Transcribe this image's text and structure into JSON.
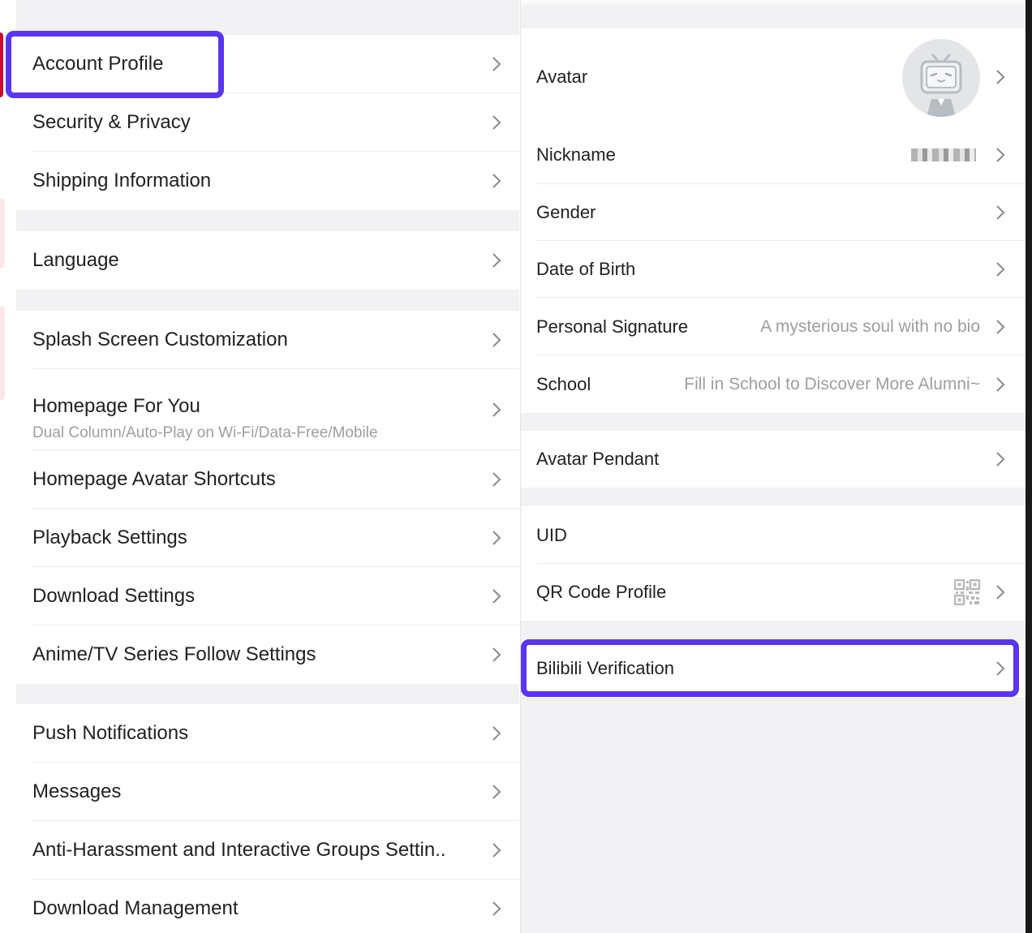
{
  "settings_menu": {
    "account_profile": "Account Profile",
    "security_privacy": "Security & Privacy",
    "shipping_information": "Shipping Information",
    "language": "Language",
    "splash_screen": "Splash Screen Customization",
    "homepage_for_you": "Homepage For You",
    "homepage_for_you_sub": "Dual Column/Auto-Play on Wi-Fi/Data-Free/Mobile",
    "homepage_avatar_shortcuts": "Homepage Avatar Shortcuts",
    "playback_settings": "Playback Settings",
    "download_settings": "Download Settings",
    "anime_tv_follow": "Anime/TV Series Follow Settings",
    "push_notifications": "Push Notifications",
    "messages": "Messages",
    "anti_harassment": "Anti-Harassment and Interactive Groups Settin..",
    "download_management": "Download Management"
  },
  "profile": {
    "avatar": "Avatar",
    "nickname": "Nickname",
    "gender": "Gender",
    "date_of_birth": "Date of Birth",
    "personal_signature": "Personal Signature",
    "personal_signature_value": "A mysterious soul with no bio",
    "school": "School",
    "school_value": "Fill in School to Discover More Alumni~",
    "avatar_pendant": "Avatar Pendant",
    "uid": "UID",
    "qr_code_profile": "QR Code Profile",
    "bilibili_verification": "Bilibili Verification"
  },
  "icons": {
    "chevron": "chevron-right-icon",
    "avatar": "default-avatar-tv-icon",
    "qr": "qr-code-icon"
  },
  "colors": {
    "highlight": "#5a36f2",
    "section_gap": "#f2f2f4",
    "secondary_text": "#9e9e9e"
  }
}
